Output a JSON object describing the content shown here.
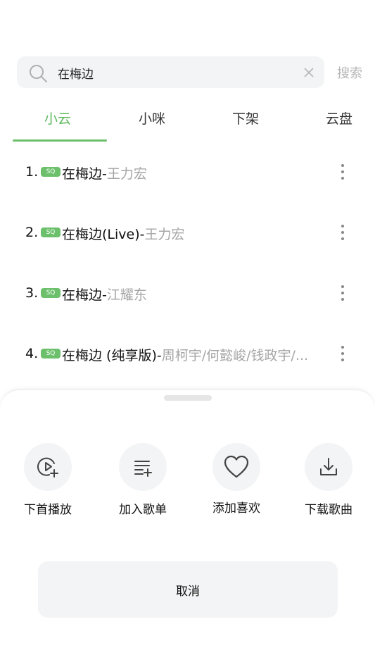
{
  "search": {
    "query": "在梅边",
    "button_label": "搜索"
  },
  "tabs": [
    {
      "label": "小云",
      "active": true
    },
    {
      "label": "小咪",
      "active": false
    },
    {
      "label": "下架",
      "active": false
    },
    {
      "label": "云盘",
      "active": false
    }
  ],
  "results": [
    {
      "index": "1.",
      "badge": "SQ",
      "song": "在梅边",
      "sep": "-",
      "artist": "王力宏"
    },
    {
      "index": "2.",
      "badge": "SQ",
      "song": "在梅边(Live)",
      "sep": "-",
      "artist": "王力宏"
    },
    {
      "index": "3.",
      "badge": "SQ",
      "song": "在梅边",
      "sep": "-",
      "artist": "江耀东"
    },
    {
      "index": "4.",
      "badge": "SQ",
      "song": "在梅边 (纯享版)",
      "sep": "-",
      "artist": "周柯宇/何懿峻/钱政宇/..."
    }
  ],
  "sheet": {
    "actions": [
      {
        "label": "下首播放",
        "icon": "play-next-icon"
      },
      {
        "label": "加入歌单",
        "icon": "add-to-playlist-icon"
      },
      {
        "label": "添加喜欢",
        "icon": "heart-icon"
      },
      {
        "label": "下载歌曲",
        "icon": "download-icon"
      }
    ],
    "cancel_label": "取消"
  },
  "colors": {
    "accent": "#5cb85c",
    "badge": "#6cc06c",
    "muted_text": "#a5a5a5",
    "surface": "#f3f4f5"
  }
}
